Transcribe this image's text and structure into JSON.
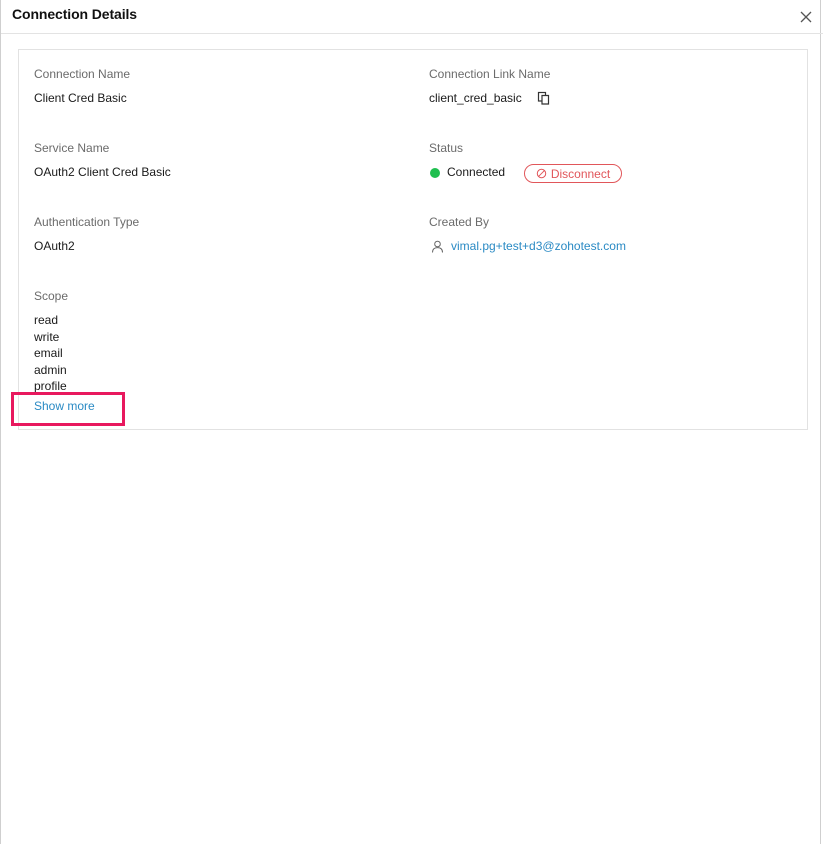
{
  "dialog": {
    "title": "Connection Details"
  },
  "fields": {
    "connection_name_label": "Connection Name",
    "connection_name_value": "Client Cred Basic",
    "connection_link_label": "Connection Link Name",
    "connection_link_value": "client_cred_basic",
    "service_name_label": "Service Name",
    "service_name_value": "OAuth2 Client Cred Basic",
    "status_label": "Status",
    "status_value": "Connected",
    "disconnect_label": "Disconnect",
    "auth_type_label": "Authentication Type",
    "auth_type_value": "OAuth2",
    "created_by_label": "Created By",
    "created_by_value": "vimal.pg+test+d3@zohotest.com",
    "scope_label": "Scope",
    "scopes": [
      "read",
      "write",
      "email",
      "admin",
      "profile"
    ],
    "show_more_label": "Show more"
  },
  "colors": {
    "status_connected": "#1fbf4f",
    "disconnect": "#e1565a",
    "link": "#2a8ac4",
    "highlight": "#e8185e"
  },
  "icons": {
    "close": "close-icon",
    "copy": "copy-icon",
    "disconnect": "ban-icon",
    "user": "user-icon"
  }
}
